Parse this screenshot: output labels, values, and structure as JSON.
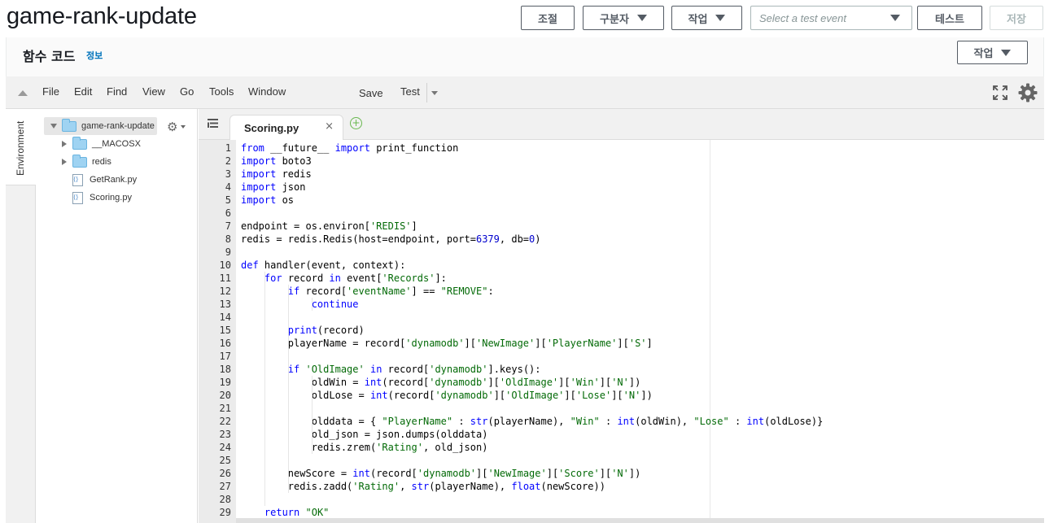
{
  "header": {
    "title": "game-rank-update",
    "buttons": {
      "throttle": "조절",
      "qualifiers": "구분자",
      "actions": "작업",
      "test": "테스트",
      "save": "저장"
    },
    "test_event_placeholder": "Select a test event"
  },
  "section": {
    "title": "함수 코드",
    "info_link": "정보",
    "actions": "작업"
  },
  "menubar": {
    "items": [
      "File",
      "Edit",
      "Find",
      "View",
      "Go",
      "Tools",
      "Window"
    ],
    "save": "Save",
    "test": "Test"
  },
  "side_tab": "Environment",
  "tree": {
    "root": "game-rank-update",
    "items": [
      "__MACOSX",
      "redis",
      "GetRank.py",
      "Scoring.py"
    ]
  },
  "editor": {
    "active_tab": "Scoring.py",
    "line_numbers": [
      "1",
      "2",
      "3",
      "4",
      "5",
      "6",
      "7",
      "8",
      "9",
      "10",
      "11",
      "12",
      "13",
      "14",
      "15",
      "16",
      "17",
      "18",
      "19",
      "20",
      "21",
      "22",
      "23",
      "24",
      "25",
      "26",
      "27",
      "28",
      "29"
    ],
    "lines": [
      "from __future__ import print_function",
      "import boto3",
      "import redis",
      "import json",
      "import os",
      "",
      "endpoint = os.environ['REDIS']",
      "redis = redis.Redis(host=endpoint, port=6379, db=0)",
      "",
      "def handler(event, context):",
      "    for record in event['Records']:",
      "        if record['eventName'] == \"REMOVE\":",
      "            continue",
      "",
      "        print(record)",
      "        playerName = record['dynamodb']['NewImage']['PlayerName']['S']",
      "",
      "        if 'OldImage' in record['dynamodb'].keys():",
      "            oldWin = int(record['dynamodb']['OldImage']['Win']['N'])",
      "            oldLose = int(record['dynamodb']['OldImage']['Lose']['N'])",
      "",
      "            olddata = { \"PlayerName\" : str(playerName), \"Win\" : int(oldWin), \"Lose\" : int(oldLose)}",
      "            old_json = json.dumps(olddata)",
      "            redis.zrem('Rating', old_json)",
      "",
      "        newScore = int(record['dynamodb']['NewImage']['Score']['N'])",
      "        redis.zadd('Rating', str(playerName), float(newScore))",
      "",
      "    return \"OK\""
    ]
  }
}
